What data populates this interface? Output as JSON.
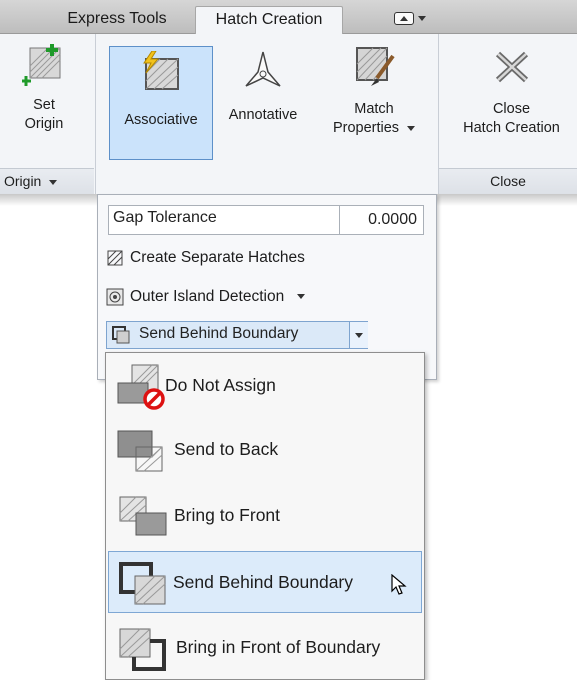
{
  "tabs": [
    {
      "label": "Express Tools"
    },
    {
      "label": "Hatch Creation"
    }
  ],
  "ribbon": {
    "origin": {
      "btn_line1": "Set",
      "btn_line2": "Origin",
      "panel_label": "Origin"
    },
    "associative": {
      "label": "Associative"
    },
    "annotative": {
      "label": "Annotative"
    },
    "match": {
      "line1": "Match",
      "line2": "Properties"
    },
    "close": {
      "line1": "Close",
      "line2": "Hatch Creation",
      "panel_label": "Close"
    }
  },
  "options": {
    "gap_tolerance_label": "Gap Tolerance",
    "gap_tolerance_value": "0.0000",
    "create_separate": "Create Separate Hatches",
    "outer_island": "Outer Island Detection",
    "draw_order": "Send Behind Boundary"
  },
  "menu": {
    "items": [
      {
        "label": "Do Not Assign",
        "icon": "do-not-assign-icon"
      },
      {
        "label": "Send to Back",
        "icon": "send-to-back-icon"
      },
      {
        "label": "Bring to Front",
        "icon": "bring-to-front-icon"
      },
      {
        "label": "Send Behind Boundary",
        "icon": "send-behind-boundary-icon",
        "selected": true
      },
      {
        "label": "Bring in Front of Boundary",
        "icon": "bring-in-front-of-boundary-icon"
      }
    ]
  },
  "colors": {
    "selection": "#dcebfa",
    "selection_border": "#7ea7d4",
    "ribbon_bg": "#f3f5f8"
  }
}
